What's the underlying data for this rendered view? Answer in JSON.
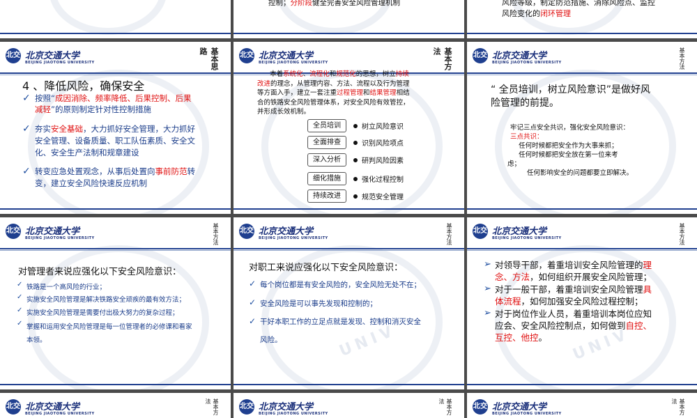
{
  "logo": {
    "name": "北京交通大学",
    "sub": "BEIJING JIAOTONG UNIVERSITY",
    "seal": "北交",
    "watermark": "UNIV"
  },
  "top_row": {
    "s2": {
      "prefix": "控制；",
      "red": "分阶段",
      "suffix": "健全完善安全风险管理机制"
    },
    "s3": {
      "line1": "风险等级，制定防范措施、消除风险点、监控",
      "line2_pre": "风险变化的",
      "line2_red": "闭环管理"
    }
  },
  "slide4": {
    "vertical": "基本思路",
    "title": "4 、降低风险，确保安全",
    "b1_pre": "按照“",
    "b1_red1": "成因消除、频率降低、后果控制、后果",
    "b1_red2": "减轻",
    "b1_post": "”的原则制定针对性控制措施",
    "b2_pre": "夯实",
    "b2_red": "安全基础",
    "b2_l1_post": "，大力抓好安全管理，大力抓好",
    "b2_l2": "安全管理、设备质量、职工队伍素质、安全文",
    "b2_l3": "化、安全生产法制和规章建设",
    "b3_pre": "转变应急处置观念，从事后处置向",
    "b3_red": "事前防范",
    "b3_l1_post": "转",
    "b3_l2": "变，建立安全风险快速反应机制"
  },
  "slide5": {
    "vertical": "基本方法",
    "p_l1_a": "本着",
    "p_l1_r1": "系统化",
    "p_l1_s1": "、",
    "p_l1_r2": "流程化",
    "p_l1_s2": "和",
    "p_l1_r3": "规范化",
    "p_l1_b": "的思想，树立",
    "p_l1_r4": "持续",
    "p_l2_r": "改进",
    "p_l2_b": "的理念，从管理内容、方法、流程以及行为管理",
    "p_l3": "等方面入手，建立一套注重",
    "p_l3_r1": "过程管理",
    "p_l3_m": "和",
    "p_l3_r2": "结果管理",
    "p_l3_e": "相结",
    "p_l4": "合的铁路安全风险管理体系，对安全风险有效管控，",
    "p_l5": "并形成长效机制。",
    "flow": [
      {
        "box": "全员培训",
        "text": "树立风险意识"
      },
      {
        "box": "全面排查",
        "text": "识别风险项点"
      },
      {
        "box": "深入分析",
        "text": "研判风险因素"
      },
      {
        "box": "细化措施",
        "text": "强化过程控制"
      },
      {
        "box": "持续改进",
        "text": "规范安全管理"
      }
    ]
  },
  "slide6": {
    "vertical": "基本方法",
    "h_l1": "“ 全员培训，树立风险意识”是做好风",
    "h_l2": "险管理的前提。",
    "p1": "牢记三点安全共识，强化安全风险意识：",
    "p2": "三点共识：",
    "p3": "任何时候都把安全作为大事来抓；",
    "p4": "任何时候都把安全放在第一位来考",
    "p5": "虑；",
    "p6": "任何影响安全的问题都要立即解决。"
  },
  "slide7": {
    "vertical": "基本方法",
    "heading": "对管理者来说应强化以下安全风险意识：",
    "items": [
      "铁路是一个高风险的行业；",
      "实施安全风险管理是解决铁路安全顽疾的最有效方法；",
      "实施安全风险管理是需要付出极大努力的复杂过程；",
      "掌握和运用安全风险管理是每一位管理者的必修课和看家",
      "本领。"
    ]
  },
  "slide8": {
    "vertical": "基本方法",
    "heading": "对职工来说应强化以下安全风险意识：",
    "items": [
      "每个岗位都是有安全风险的，安全风险无处不在；",
      "安全风险是可以事先发现和控制的；",
      "干好本职工作的立足点就是发现、控制和消灭安全",
      "风险。"
    ]
  },
  "slide9": {
    "vertical": "基本方法",
    "b1_pre": "对领导干部，着重培训安全风险管理的",
    "b1_red1": "理",
    "b1_red2": "念、方法",
    "b1_post": "，如何组织开展安全风险管理；",
    "b2_pre": "对于一般干部，着重培训安全风险管理",
    "b2_red1": "具",
    "b2_red2": "体流程",
    "b2_post": "，如何加强安全风险过程控制；",
    "b3_l1": "对于岗位作业人员，着重培训本岗位应知",
    "b3_l2": "应会、安全风险控制点，如何做到",
    "b3_red1": "自控、",
    "b3_red2": "互控、他控",
    "b3_post": "。"
  },
  "bottom_row": {
    "vertical": "基本方法"
  },
  "colors": {
    "accent": "#1f3f8f",
    "highlight": "#e01010",
    "body": "#1a3c8a"
  }
}
